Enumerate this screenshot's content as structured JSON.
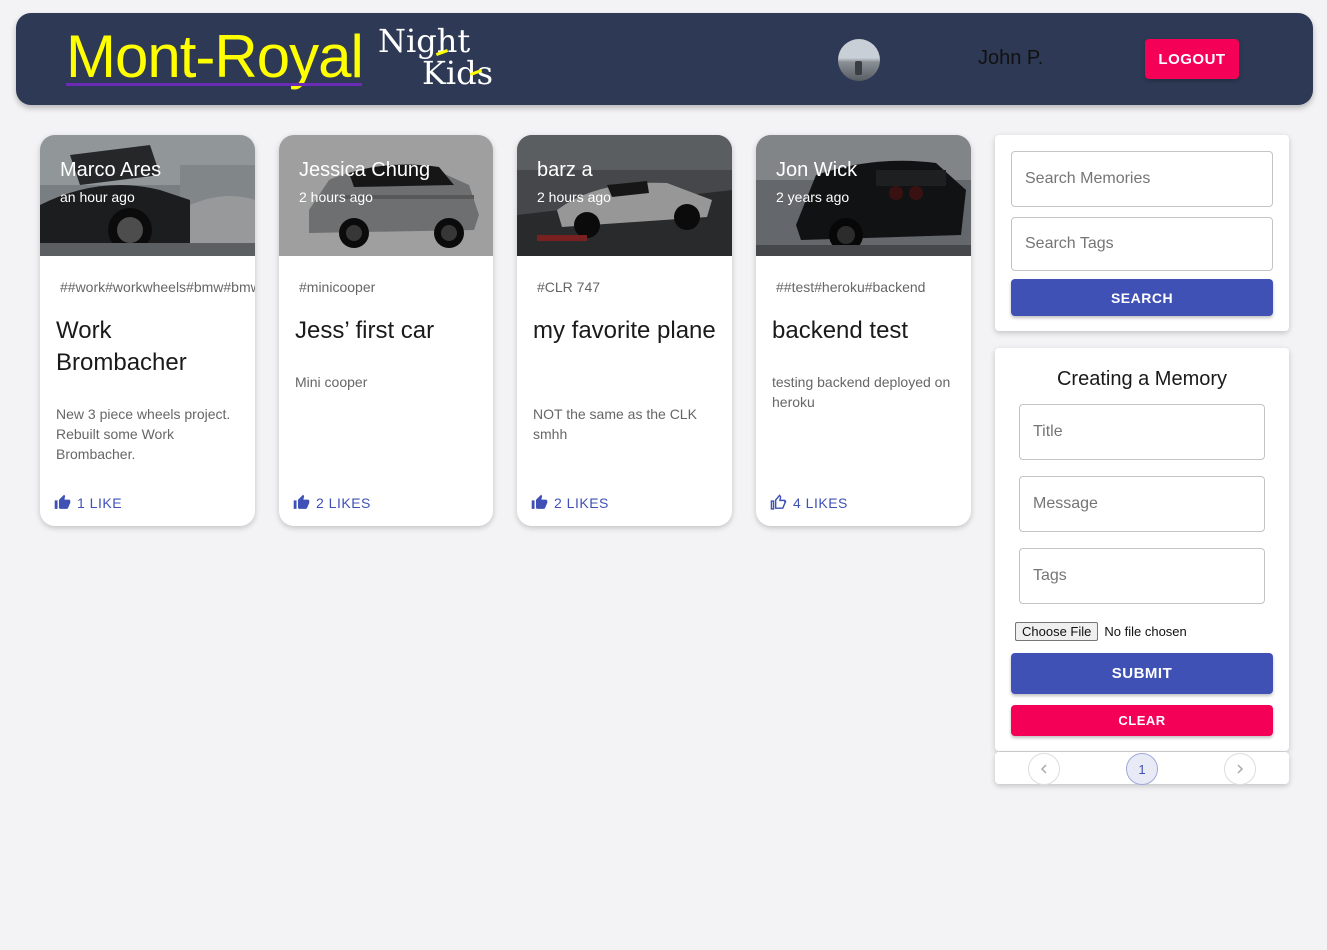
{
  "header": {
    "brand": "Mont-Royal",
    "sub_logo_line1": "Night",
    "sub_logo_line2": "Kids",
    "username": "John P.",
    "logout_label": "LOGOUT"
  },
  "posts": [
    {
      "creator": "Marco Ares",
      "time": "an hour ago",
      "tags": "##work#workwheels#bmw#bmw",
      "title": "Work Brombacher",
      "message": "New 3 piece wheels project. Rebuilt some Work Brombacher.",
      "likes": "1 LIKE"
    },
    {
      "creator": "Jessica Chung",
      "time": "2 hours ago",
      "tags": "#minicooper",
      "title": "Jess’ first car",
      "message": "Mini cooper",
      "likes": "2 LIKES"
    },
    {
      "creator": "barz a",
      "time": "2 hours ago",
      "tags": "#CLR 747",
      "title": "my favorite plane",
      "message": "NOT the same as the CLK smhh",
      "likes": "2 LIKES"
    },
    {
      "creator": "Jon Wick",
      "time": "2 years ago",
      "tags": "##test#heroku#backend",
      "title": "backend test",
      "message": "testing backend deployed on heroku",
      "likes": "4 LIKES"
    }
  ],
  "search": {
    "memories_placeholder": "Search Memories",
    "tags_placeholder": "Search Tags",
    "button_label": "SEARCH"
  },
  "form": {
    "title": "Creating a Memory",
    "title_placeholder": "Title",
    "message_placeholder": "Message",
    "tags_placeholder": "Tags",
    "choose_file_label": "Choose File",
    "file_status": "No file chosen",
    "submit_label": "SUBMIT",
    "clear_label": "CLEAR"
  },
  "pagination": {
    "current_page": "1",
    "prev_icon": "chevron-left-icon",
    "next_icon": "chevron-right-icon"
  },
  "colors": {
    "appbar": "#2e3a55",
    "brand": "#ffff00",
    "primary": "#3f51b5",
    "secondary": "#f50057"
  }
}
